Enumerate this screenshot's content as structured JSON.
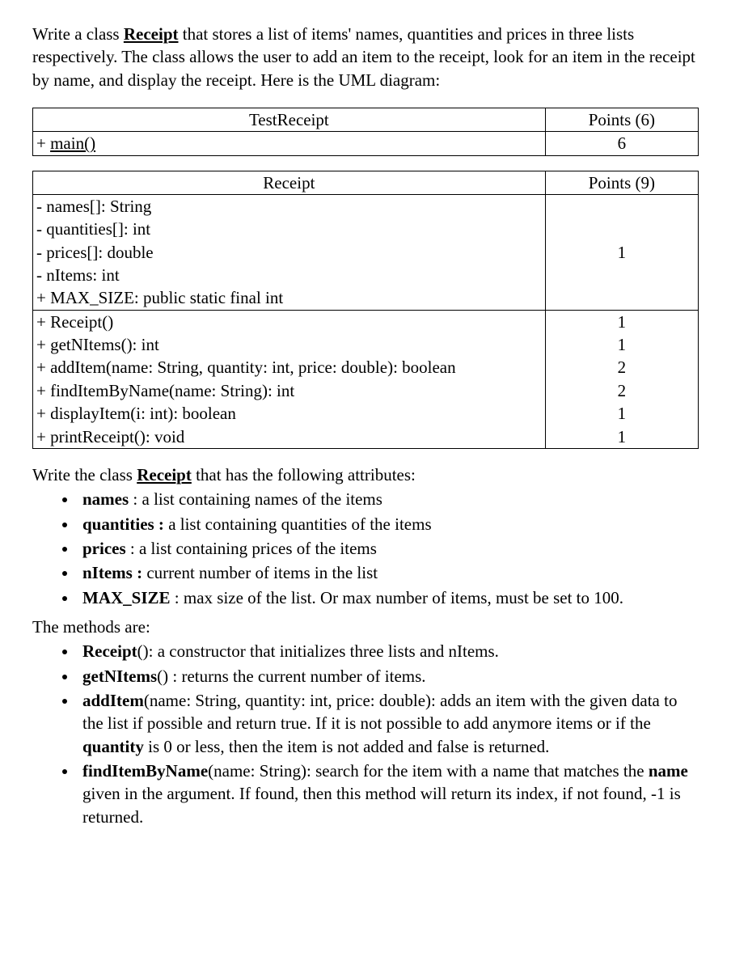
{
  "intro": {
    "pre": "Write a class ",
    "className": "Receipt",
    "post": " that stores a list of items' names, quantities and prices in three lists respectively. The class allows the user to add an item to the receipt, look for an item in the receipt by name, and display the receipt. Here is the UML diagram:"
  },
  "table1": {
    "headerLeft": "TestReceipt",
    "headerRight": "Points (6)",
    "row1Left": "main()",
    "row1Right": "6"
  },
  "table2": {
    "headerLeft": "Receipt",
    "headerRight": "Points (9)",
    "attrs": [
      "- names[]: String",
      "- quantities[]: int",
      "- prices[]: double",
      "- nItems: int",
      "+ MAX_SIZE: public static final int"
    ],
    "attrsPts": "1",
    "methods": [
      {
        "sig": "+ Receipt()",
        "pts": "1"
      },
      {
        "sig": "+ getNItems(): int",
        "pts": "1"
      },
      {
        "sig": "+ addItem(name: String, quantity: int, price: double): boolean",
        "pts": "2"
      },
      {
        "sig": "+ findItemByName(name: String): int",
        "pts": "2"
      },
      {
        "sig": "+ displayItem(i: int): boolean",
        "pts": "1"
      },
      {
        "sig": "+ printReceipt(): void",
        "pts": "1"
      }
    ]
  },
  "desc": {
    "attrHeadingPre": "Write the class ",
    "attrHeadingClass": "Receipt",
    "attrHeadingPost": " that has the following attributes:",
    "attrBullets": [
      {
        "b": "names",
        "rest": " : a list containing names of the items"
      },
      {
        "b": "quantities :",
        "rest": " a list containing quantities of the items"
      },
      {
        "b": "prices",
        "rest": " : a list containing prices of the items"
      },
      {
        "b": "nItems :",
        "rest": " current number of items in the list"
      },
      {
        "b": "MAX_SIZE",
        "rest": " : max size of the list. Or max number of items, must be set to 100."
      }
    ],
    "methodHeading": "The methods are:",
    "methodBullets": [
      {
        "b": "Receipt",
        "rest": "(): a constructor that initializes three lists and nItems."
      },
      {
        "b": "getNItems",
        "rest": "() : returns the current number of items."
      },
      {
        "b": "addItem",
        "pre": "(name: String, quantity: int, price: double): adds an item with the given data to the list if possible and return true. If it is not possible to add anymore items or if the ",
        "b2": "quantity",
        "post": " is 0 or less, then the item is not added and false is returned."
      },
      {
        "b": "findItemByName",
        "pre": "(name: String): search for the item with a name that matches the ",
        "b2": "name",
        "post": " given in the argument. If found, then this method will return its index, if not found, -1 is returned."
      }
    ]
  }
}
